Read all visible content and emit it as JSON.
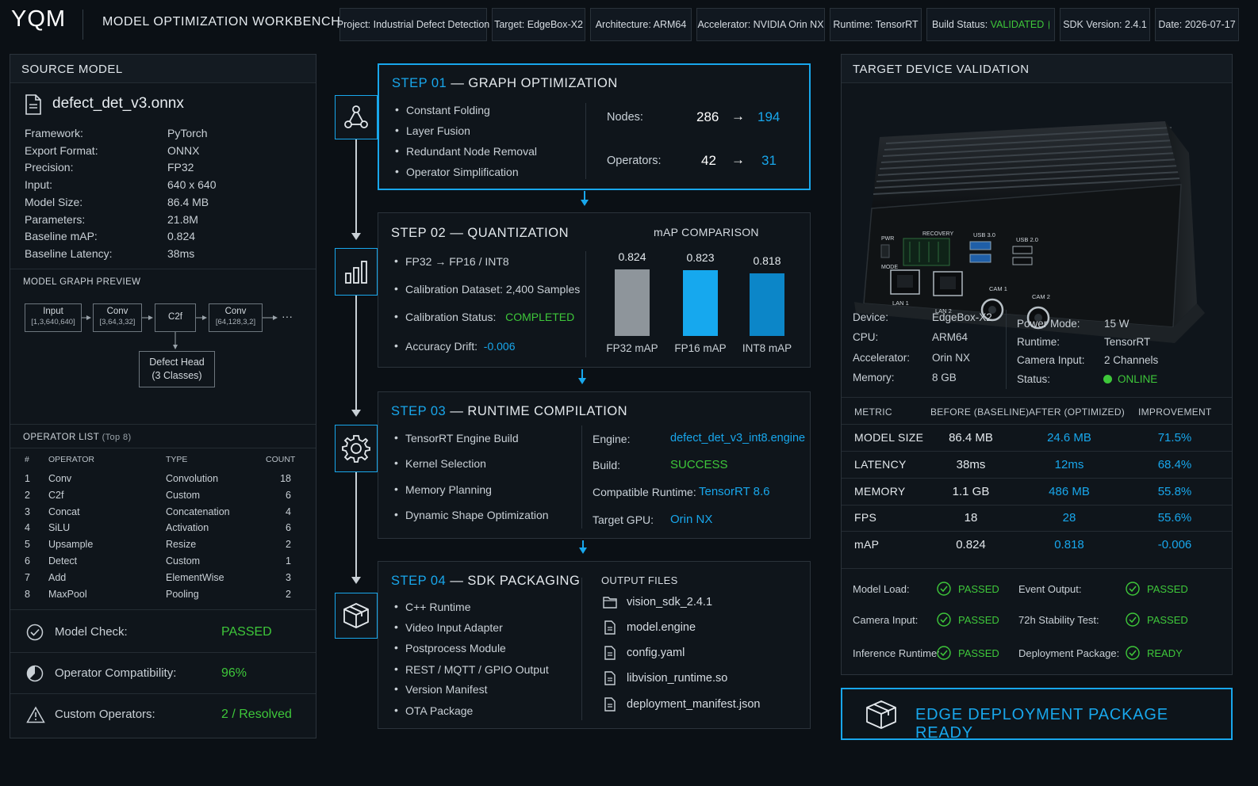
{
  "header": {
    "logo": "YQM",
    "title": "MODEL OPTIMIZATION WORKBENCH",
    "chips": {
      "project": "Project: Industrial Defect Detection",
      "target": "Target: EdgeBox-X2",
      "architecture": "Architecture: ARM64",
      "accelerator": "Accelerator: NVIDIA Orin NX",
      "runtime": "Runtime: TensorRT",
      "build_label": "Build Status:",
      "build_value": "VALIDATED",
      "sdk": "SDK Version: 2.4.1",
      "date": "Date: 2026-07-17"
    }
  },
  "source": {
    "title": "SOURCE MODEL",
    "filename": "defect_det_v3.onnx",
    "props": [
      {
        "k": "Framework:",
        "v": "PyTorch"
      },
      {
        "k": "Export Format:",
        "v": "ONNX"
      },
      {
        "k": "Precision:",
        "v": "FP32"
      },
      {
        "k": "Input:",
        "v": "640 x 640"
      },
      {
        "k": "Model Size:",
        "v": "86.4 MB"
      },
      {
        "k": "Parameters:",
        "v": "21.8M"
      },
      {
        "k": "Baseline mAP:",
        "v": "0.824"
      },
      {
        "k": "Baseline Latency:",
        "v": "38ms"
      }
    ],
    "graph_title": "MODEL GRAPH PREVIEW",
    "graph": {
      "input": "Input",
      "input_sub": "[1,3,640,640]",
      "conv1": "Conv",
      "conv1_sub": "[3,64,3,32]",
      "c2f": "C2f",
      "conv2": "Conv",
      "conv2_sub": "[64,128,3,2]",
      "ellipsis": "···",
      "head": "Defect Head",
      "head_sub": "(3 Classes)"
    },
    "ops_title": "OPERATOR LIST",
    "ops_sub": "(Top 8)",
    "ops_headers": [
      "#",
      "OPERATOR",
      "TYPE",
      "COUNT"
    ],
    "ops": [
      [
        "1",
        "Conv",
        "Convolution",
        "18"
      ],
      [
        "2",
        "C2f",
        "Custom",
        "6"
      ],
      [
        "3",
        "Concat",
        "Concatenation",
        "4"
      ],
      [
        "4",
        "SiLU",
        "Activation",
        "6"
      ],
      [
        "5",
        "Upsample",
        "Resize",
        "2"
      ],
      [
        "6",
        "Detect",
        "Custom",
        "1"
      ],
      [
        "7",
        "Add",
        "ElementWise",
        "3"
      ],
      [
        "8",
        "MaxPool",
        "Pooling",
        "2"
      ]
    ],
    "checks": [
      {
        "label": "Model Check:",
        "value": "PASSED"
      },
      {
        "label": "Operator Compatibility:",
        "value": "96%"
      },
      {
        "label": "Custom Operators:",
        "value": "2 / Resolved"
      }
    ]
  },
  "steps": {
    "s1": {
      "num": "STEP 01",
      "name": " — GRAPH OPTIMIZATION",
      "bullets": [
        "Constant Folding",
        "Layer Fusion",
        "Redundant Node Removal",
        "Operator Simplification"
      ],
      "nodes_label": "Nodes:",
      "nodes_before": "286",
      "nodes_after": "194",
      "ops_label": "Operators:",
      "ops_before": "42",
      "ops_after": "31",
      "arrow": "→"
    },
    "s2": {
      "num": "STEP 02",
      "name": " — QUANTIZATION",
      "b1": "FP32 → FP16 / INT8",
      "b2": "Calibration Dataset: 2,400 Samples",
      "b3_label": "Calibration Status:",
      "b3_value": "COMPLETED",
      "b4_label": "Accuracy Drift:",
      "b4_value": "-0.006",
      "chart_title": "mAP COMPARISON"
    },
    "s3": {
      "num": "STEP 03",
      "name": " — RUNTIME COMPILATION",
      "bullets": [
        "TensorRT Engine Build",
        "Kernel Selection",
        "Memory Planning",
        "Dynamic Shape Optimization"
      ],
      "engine_label": "Engine:",
      "engine_value": "defect_det_v3_int8.engine",
      "build_label": "Build:",
      "build_value": "SUCCESS",
      "runtime_label": "Compatible Runtime:",
      "runtime_value": "TensorRT 8.6",
      "gpu_label": "Target GPU:",
      "gpu_value": "Orin NX"
    },
    "s4": {
      "num": "STEP 04",
      "name": " — SDK PACKAGING",
      "bullets": [
        "C++ Runtime",
        "Video Input Adapter",
        "Postprocess Module",
        "REST / MQTT / GPIO Output",
        "Version Manifest",
        "OTA Package"
      ],
      "files_title": "OUTPUT FILES",
      "files": [
        "vision_sdk_2.4.1",
        "model.engine",
        "config.yaml",
        "libvision_runtime.so",
        "deployment_manifest.json"
      ]
    }
  },
  "chart_data": {
    "type": "bar",
    "title": "mAP COMPARISON",
    "categories": [
      "FP32 mAP",
      "FP16 mAP",
      "INT8 mAP"
    ],
    "values": [
      0.824,
      0.823,
      0.818
    ],
    "labels": [
      "0.824",
      "0.823",
      "0.818"
    ],
    "colors": [
      "#8e959b",
      "#16a8ee",
      "#0c86c8"
    ]
  },
  "device": {
    "title": "TARGET DEVICE VALIDATION",
    "labels": {
      "pwr": "PWR",
      "recovery": "RECOVERY",
      "mode": "MODE",
      "usb3": "USB 3.0",
      "usb2": "USB 2.0",
      "lan1": "LAN 1",
      "lan2": "LAN 2",
      "cam1": "CAM 1",
      "cam2": "CAM 2"
    },
    "left": [
      {
        "k": "Device:",
        "v": "EdgeBox-X2"
      },
      {
        "k": "CPU:",
        "v": "ARM64"
      },
      {
        "k": "Accelerator:",
        "v": "Orin NX"
      },
      {
        "k": "Memory:",
        "v": "8 GB"
      }
    ],
    "right": [
      {
        "k": "Power Mode:",
        "v": "15 W"
      },
      {
        "k": "Runtime:",
        "v": "TensorRT"
      },
      {
        "k": "Camera Input:",
        "v": "2 Channels"
      },
      {
        "k": "Status:",
        "v": "ONLINE"
      }
    ]
  },
  "metrics": {
    "headers": [
      "METRIC",
      "BEFORE (BASELINE)",
      "AFTER (OPTIMIZED)",
      "IMPROVEMENT"
    ],
    "rows": [
      [
        "MODEL SIZE",
        "86.4 MB",
        "24.6 MB",
        "71.5%"
      ],
      [
        "LATENCY",
        "38ms",
        "12ms",
        "68.4%"
      ],
      [
        "MEMORY",
        "1.1 GB",
        "486 MB",
        "55.8%"
      ],
      [
        "FPS",
        "18",
        "28",
        "55.6%"
      ],
      [
        "mAP",
        "0.824",
        "0.818",
        "-0.006"
      ]
    ]
  },
  "validation": [
    {
      "k": "Model Load:",
      "v": "PASSED"
    },
    {
      "k": "Event Output:",
      "v": "PASSED"
    },
    {
      "k": "Camera Input:",
      "v": "PASSED"
    },
    {
      "k": "72h Stability Test:",
      "v": "PASSED"
    },
    {
      "k": "Inference Runtime:",
      "v": "PASSED"
    },
    {
      "k": "Deployment Package:",
      "v": "READY"
    }
  ],
  "deploy_label": "EDGE DEPLOYMENT PACKAGE READY"
}
